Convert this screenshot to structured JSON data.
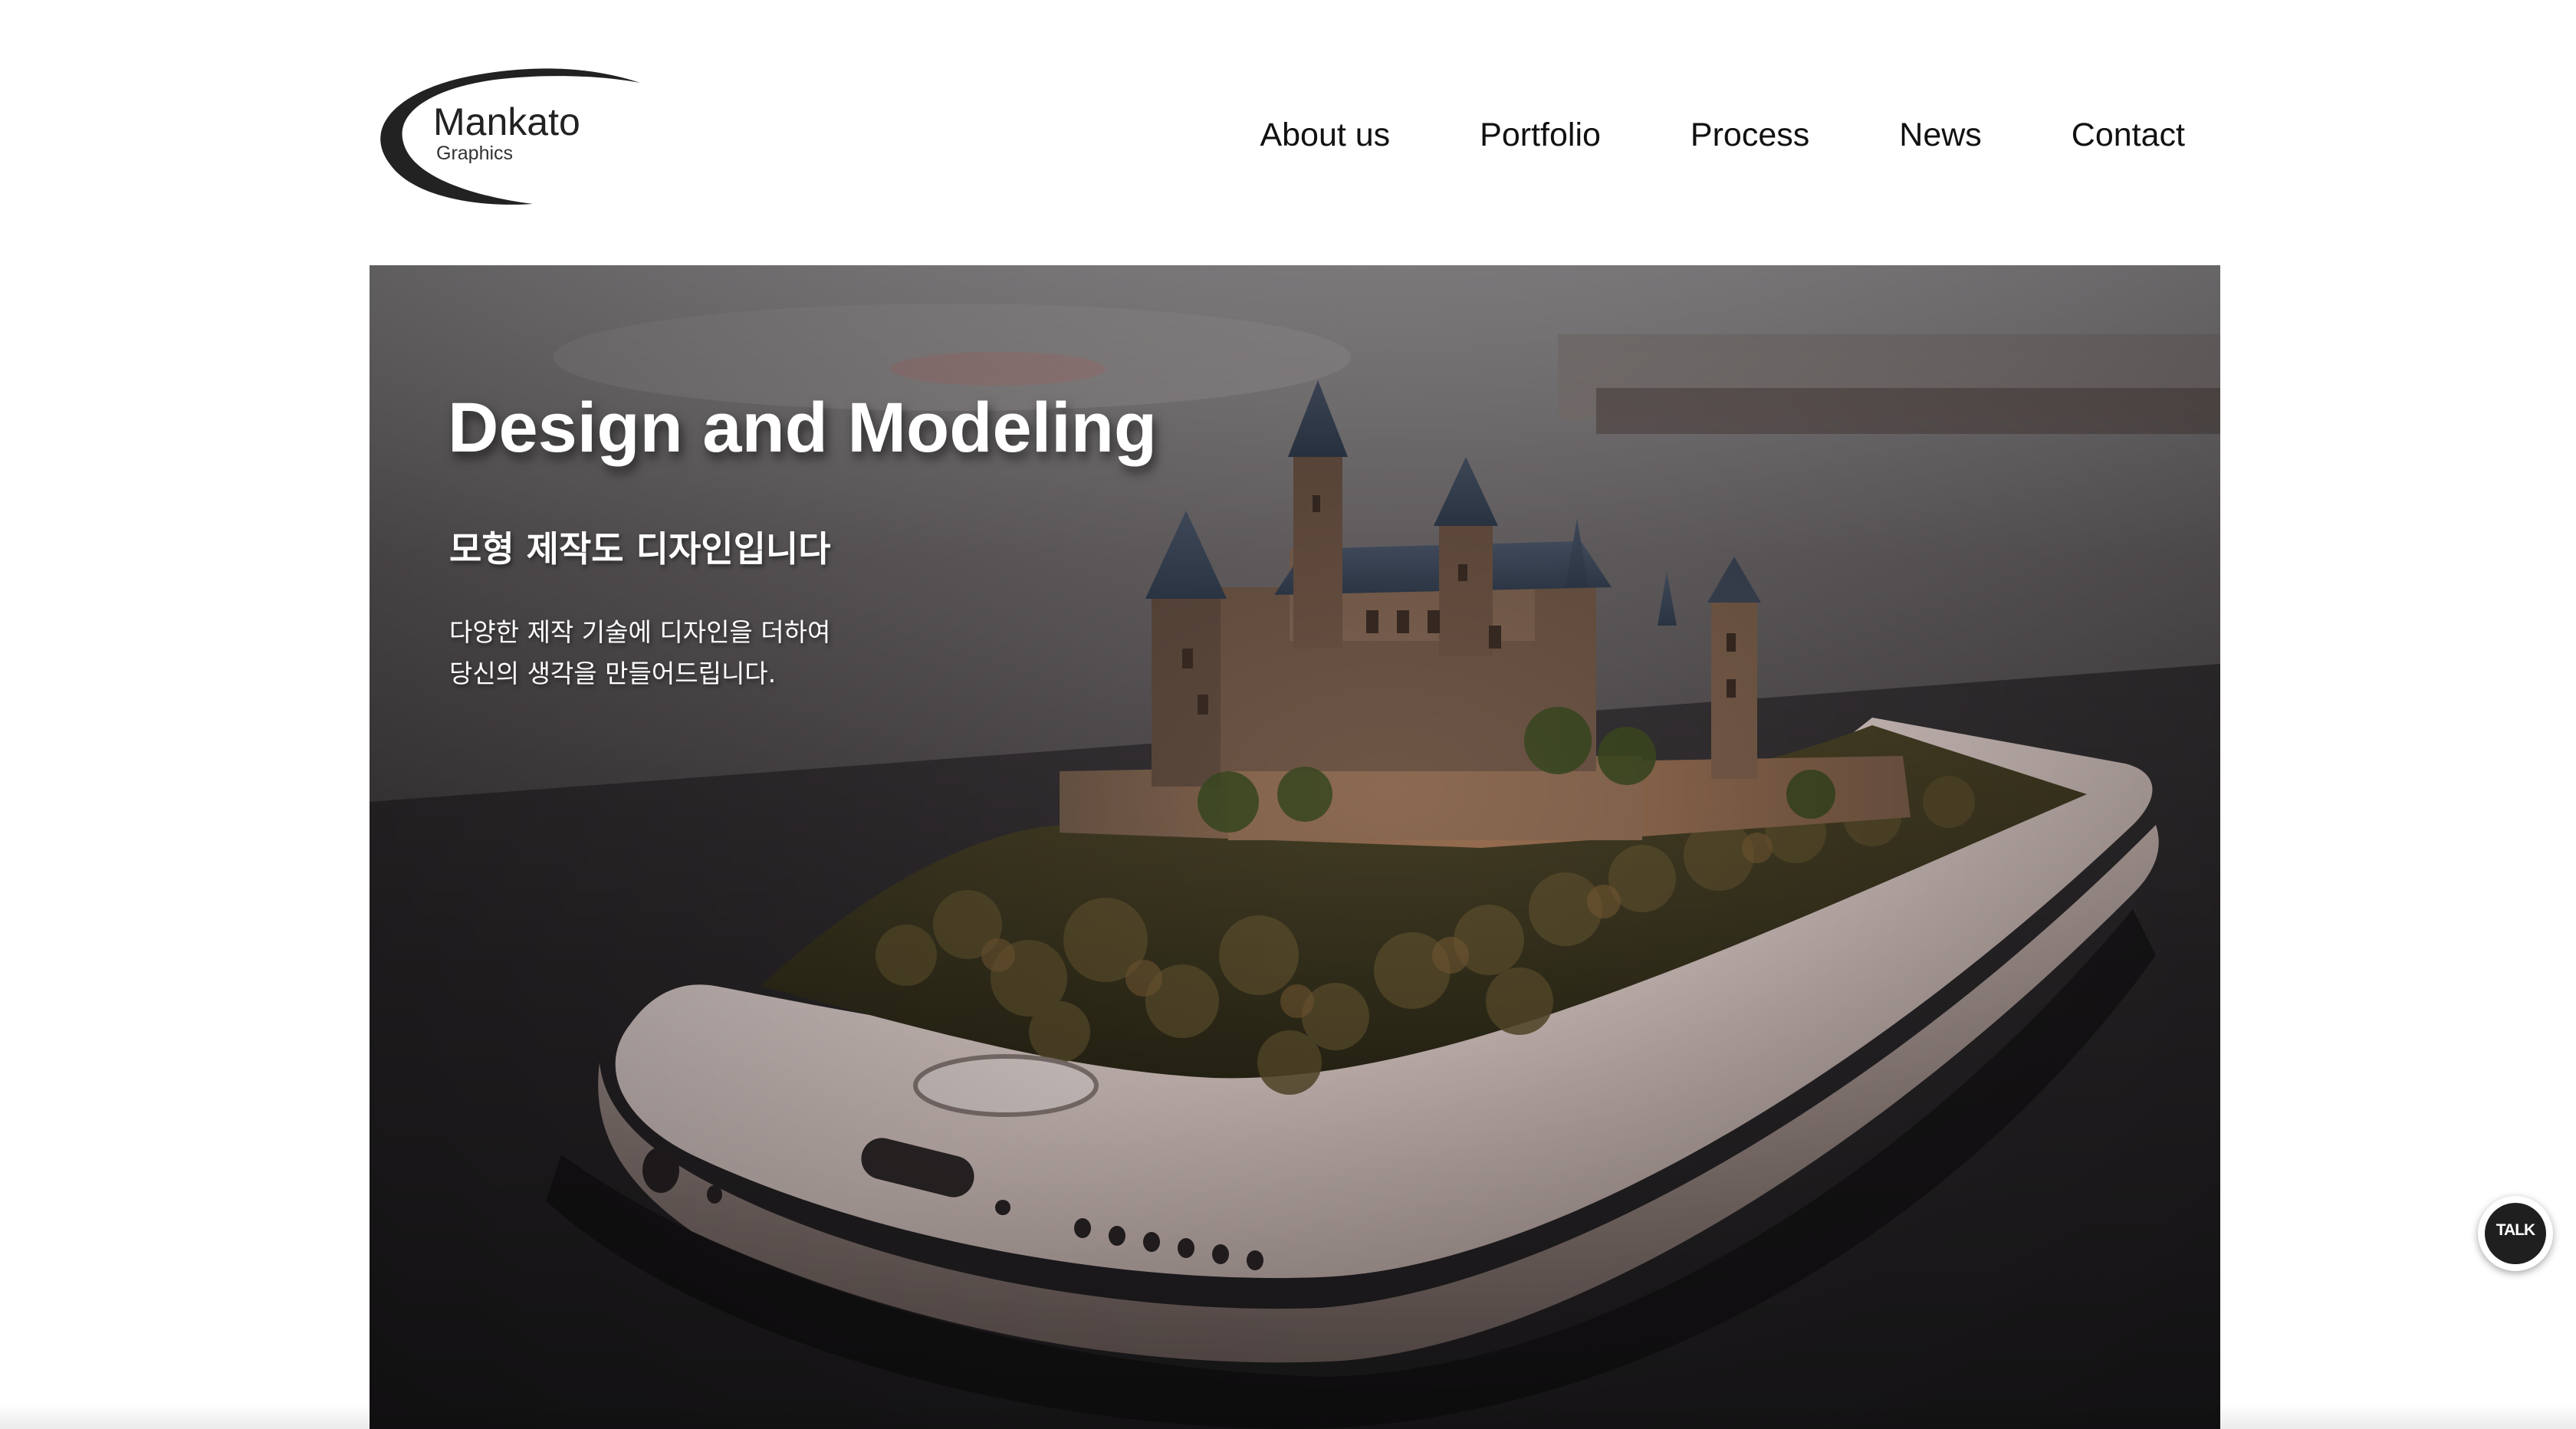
{
  "header": {
    "logo": {
      "name": "Mankato",
      "sub": "Graphics"
    },
    "nav": [
      {
        "label": "About us"
      },
      {
        "label": "Portfolio"
      },
      {
        "label": "Process"
      },
      {
        "label": "News"
      },
      {
        "label": "Contact"
      }
    ]
  },
  "hero": {
    "title": "Design and Modeling",
    "subtitle": "모형 제작도 디자인입니다",
    "description": [
      "다양한 제작 기술에 디자인을 더하여",
      "당신의 생각을 만들어드립니다."
    ]
  },
  "talk_button": {
    "label": "TALK"
  },
  "colors": {
    "text": "#111111",
    "background": "#ffffff",
    "talk_bubble": "#1f1f1f"
  }
}
